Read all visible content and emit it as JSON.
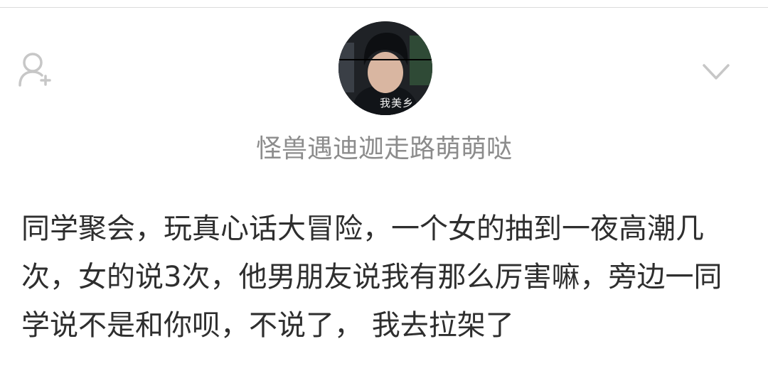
{
  "header": {
    "follow_icon": "add-user-icon",
    "more_icon": "chevron-down-icon"
  },
  "author": {
    "avatar_caption": "我美乡",
    "username": "怪兽遇迪迦走路萌萌哒"
  },
  "post": {
    "text": "同学聚会，玩真心话大冒险，一个女的抽到一夜高潮几次，女的说3次，他男朋友说我有那么厉害嘛，旁边一同学说不是和你呗，不说了， 我去拉架了"
  },
  "colors": {
    "icon": "#c7c7c7",
    "username": "#8c8c8c",
    "body_text": "#2e2e2e"
  }
}
